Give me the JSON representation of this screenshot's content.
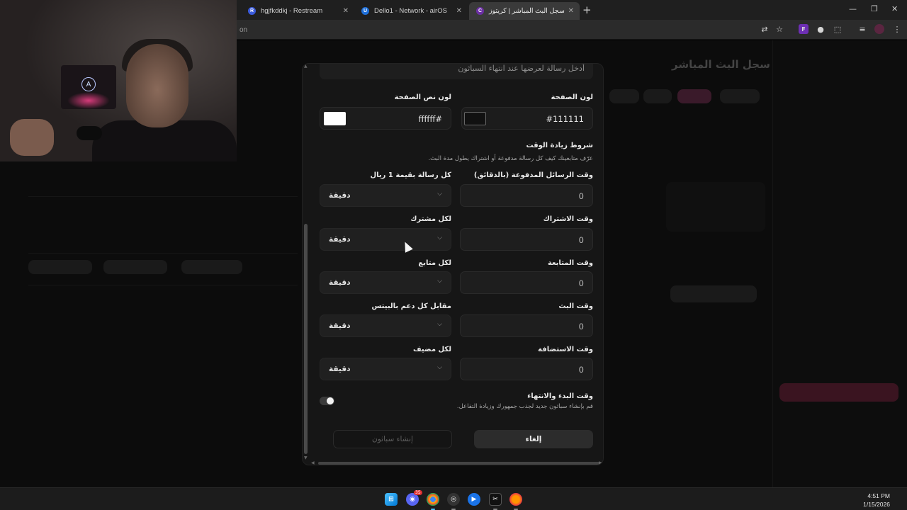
{
  "browser": {
    "tabs": [
      {
        "label": "hgjfkddkj - Restream",
        "favicon": "R",
        "color": "#3b5bdb"
      },
      {
        "label": "Dello1 - Network - airOS",
        "favicon": "U",
        "color": "#1e6fd9"
      },
      {
        "label": "سجل البث المباشر | كريتوز",
        "favicon": "C",
        "color": "#6b2fa3"
      }
    ],
    "address_fragment": "on"
  },
  "background_page": {
    "title": "سجل البث المباشر"
  },
  "modal": {
    "message_placeholder": "أدخل رسالة لعرضها عند انتهاء السباثون",
    "page_color_label": "لون الصفحة",
    "page_color_value": "#111111",
    "page_color_swatch": "#111111",
    "text_color_label": "لون نص الصفحة",
    "text_color_value": "ffffff#",
    "text_color_swatch": "#ffffff",
    "time_section_title": "شروط زيادة الوقت",
    "time_section_desc": "عرّف متابعينك كيف كل رسالة مدفوعة أو اشتراك يطول مدة البث.",
    "rows": [
      {
        "label": "وقت الرسائل المدفوعة (بالدقائق)",
        "value": "0",
        "unit_label": "كل رسالة بقيمة 1 ريال",
        "unit": "دقيقة"
      },
      {
        "label": "وقت الاشتراك",
        "value": "0",
        "unit_label": "لكل مشترك",
        "unit": "دقيقة"
      },
      {
        "label": "وقت المتابعة",
        "value": "0",
        "unit_label": "لكل متابع",
        "unit": "دقيقة"
      },
      {
        "label": "وقت البث",
        "value": "0",
        "unit_label": "مقابل كل دعم بالبيتس",
        "unit": "دقيقة"
      },
      {
        "label": "وقت الاستضافة",
        "value": "0",
        "unit_label": "لكل مضيف",
        "unit": "دقيقة"
      }
    ],
    "start_end_title": "وقت البدء والانتهاء",
    "start_end_desc": "قم بإنشاء سباثون جديد لجذب جمهورك وزيادة التفاعل.",
    "toggle_on": true,
    "cancel_label": "إلغاء",
    "create_label": "إنشاء سباثون"
  },
  "taskbar": {
    "time": "4:51 PM",
    "date": "1/15/2026",
    "discord_badge": "35"
  }
}
